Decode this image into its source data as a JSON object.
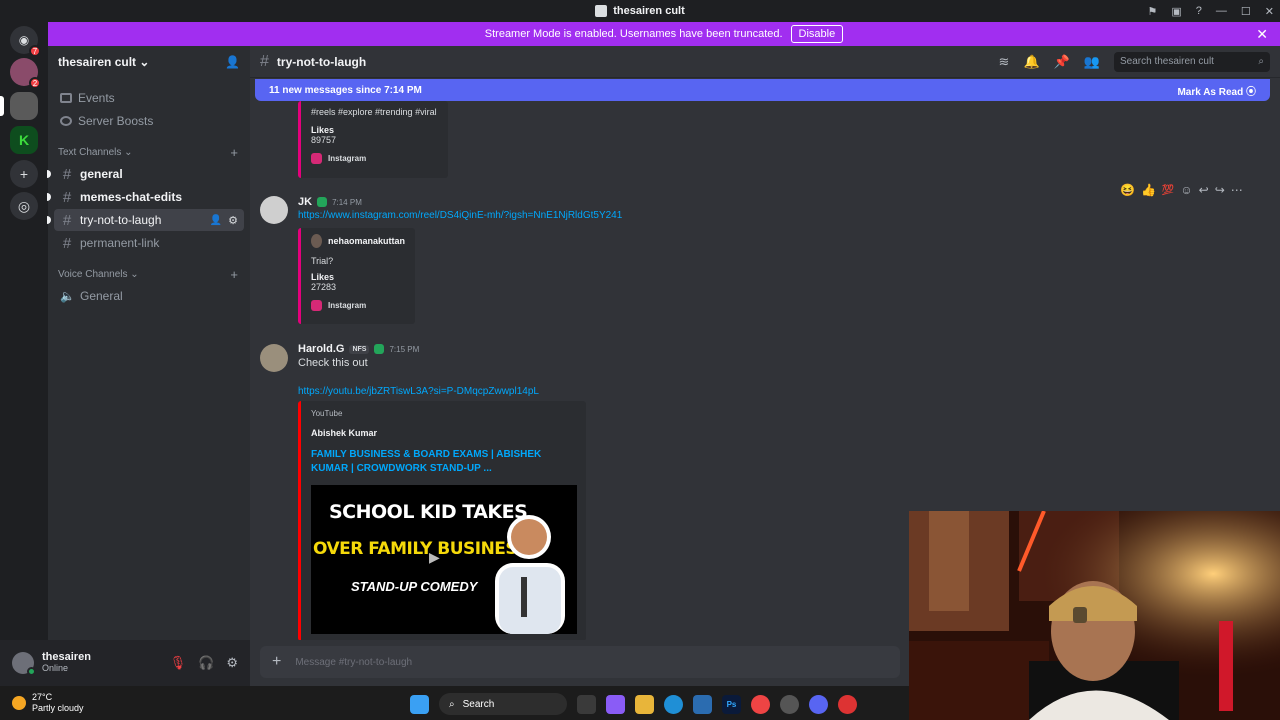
{
  "titlebar": {
    "title": "thesairen cult"
  },
  "banner": {
    "text": "Streamer Mode is enabled. Usernames have been truncated.",
    "disable_label": "Disable"
  },
  "server_badges": {
    "home": "7",
    "srv1": "2"
  },
  "guild": {
    "name": "thesairen cult"
  },
  "sidebar": {
    "top_items": [
      {
        "label": "Events"
      },
      {
        "label": "Server Boosts"
      }
    ],
    "text_category": "Text Channels",
    "text_channels": [
      {
        "label": "general"
      },
      {
        "label": "memes-chat-edits"
      },
      {
        "label": "try-not-to-laugh"
      },
      {
        "label": "permanent-link"
      }
    ],
    "voice_category": "Voice Channels",
    "voice_channels": [
      {
        "label": "General"
      }
    ]
  },
  "user": {
    "name": "thesairen",
    "status": "Online"
  },
  "channel_header": {
    "name": "try-not-to-laugh",
    "search_placeholder": "Search thesairen cult"
  },
  "new_messages_bar": {
    "text": "11 new messages since 7:14 PM",
    "action": "Mark As Read"
  },
  "messages": [
    {
      "embed": {
        "description": "#reels #explore #trending #viral",
        "likes_label": "Likes",
        "likes": "89757",
        "footer": "Instagram"
      }
    },
    {
      "author": "JK",
      "time": "7:14 PM",
      "link": "https://www.instagram.com/reel/DS4iQinE-mh/?igsh=NnE1NjRldGt5Y241",
      "embed": {
        "author": "nehaomanakuttan",
        "description": "Trial?",
        "likes_label": "Likes",
        "likes": "27283",
        "footer": "Instagram"
      }
    },
    {
      "author": "Harold.G",
      "tag": "NFS",
      "time": "7:15 PM",
      "text": "Check this out",
      "link": "https://youtu.be/jbZRTiswL3A?si=P-DMqcpZwwpl14pL",
      "embed": {
        "provider": "YouTube",
        "author": "Abishek Kumar",
        "title": "FAMILY BUSINESS & BOARD EXAMS | ABISHEK KUMAR | CROWDWORK STAND-UP ...",
        "thumb_line1": "SCHOOL KID TAKES",
        "thumb_line2": "OVER FAMILY BUSINESS",
        "thumb_line3": "STAND-UP COMEDY"
      }
    }
  ],
  "composer": {
    "placeholder": "Message #try-not-to-laugh"
  },
  "taskbar": {
    "temp": "27°C",
    "weather": "Partly cloudy",
    "search": "Search"
  }
}
